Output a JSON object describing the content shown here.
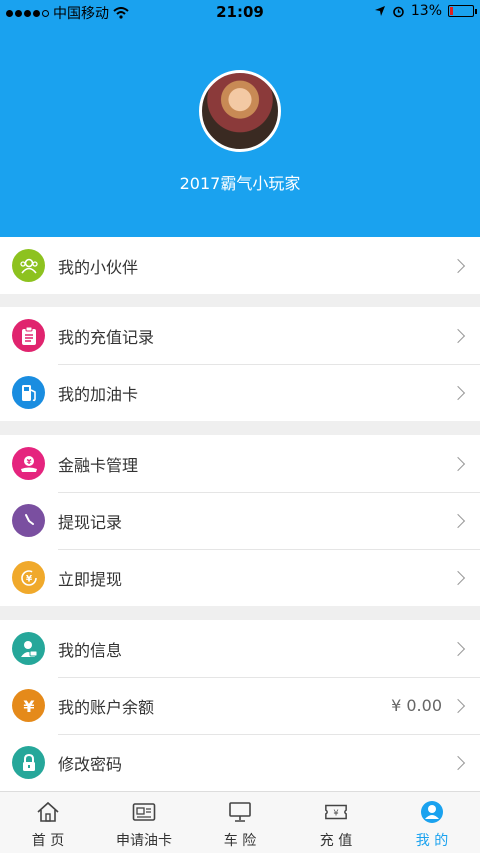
{
  "status_bar": {
    "carrier": "中国移动",
    "time": "21:09",
    "battery": "13%",
    "battery_level": 0.13
  },
  "profile": {
    "username": "2017霸气小玩家"
  },
  "menu_groups": [
    [
      {
        "label": "我的小伙伴",
        "icon": "partners-icon",
        "color": "#8dc21f"
      }
    ],
    [
      {
        "label": "我的充值记录",
        "icon": "clipboard-icon",
        "color": "#e0246e"
      },
      {
        "label": "我的加油卡",
        "icon": "fuel-pump-icon",
        "color": "#1a8de0"
      }
    ],
    [
      {
        "label": "金融卡管理",
        "icon": "yuan-hand-icon",
        "color": "#e5247e"
      },
      {
        "label": "提现记录",
        "icon": "clock-icon",
        "color": "#7a4fa0"
      },
      {
        "label": "立即提现",
        "icon": "yuan-coin-icon",
        "color": "#f0a92b"
      }
    ],
    [
      {
        "label": "我的信息",
        "icon": "user-card-icon",
        "color": "#26a79a"
      },
      {
        "label": "我的账户余额",
        "icon": "yuan-icon",
        "color": "#e58a1a",
        "value": "¥ 0.00"
      },
      {
        "label": "修改密码",
        "icon": "lock-icon",
        "color": "#26a79a"
      }
    ]
  ],
  "tabs": [
    {
      "label": "首 页",
      "icon": "home-icon"
    },
    {
      "label": "申请油卡",
      "icon": "card-icon"
    },
    {
      "label": "车 险",
      "icon": "monitor-icon"
    },
    {
      "label": "充 值",
      "icon": "ticket-icon"
    },
    {
      "label": "我 的",
      "icon": "profile-icon",
      "active": true
    }
  ],
  "colors": {
    "primary": "#1aa2ef"
  }
}
